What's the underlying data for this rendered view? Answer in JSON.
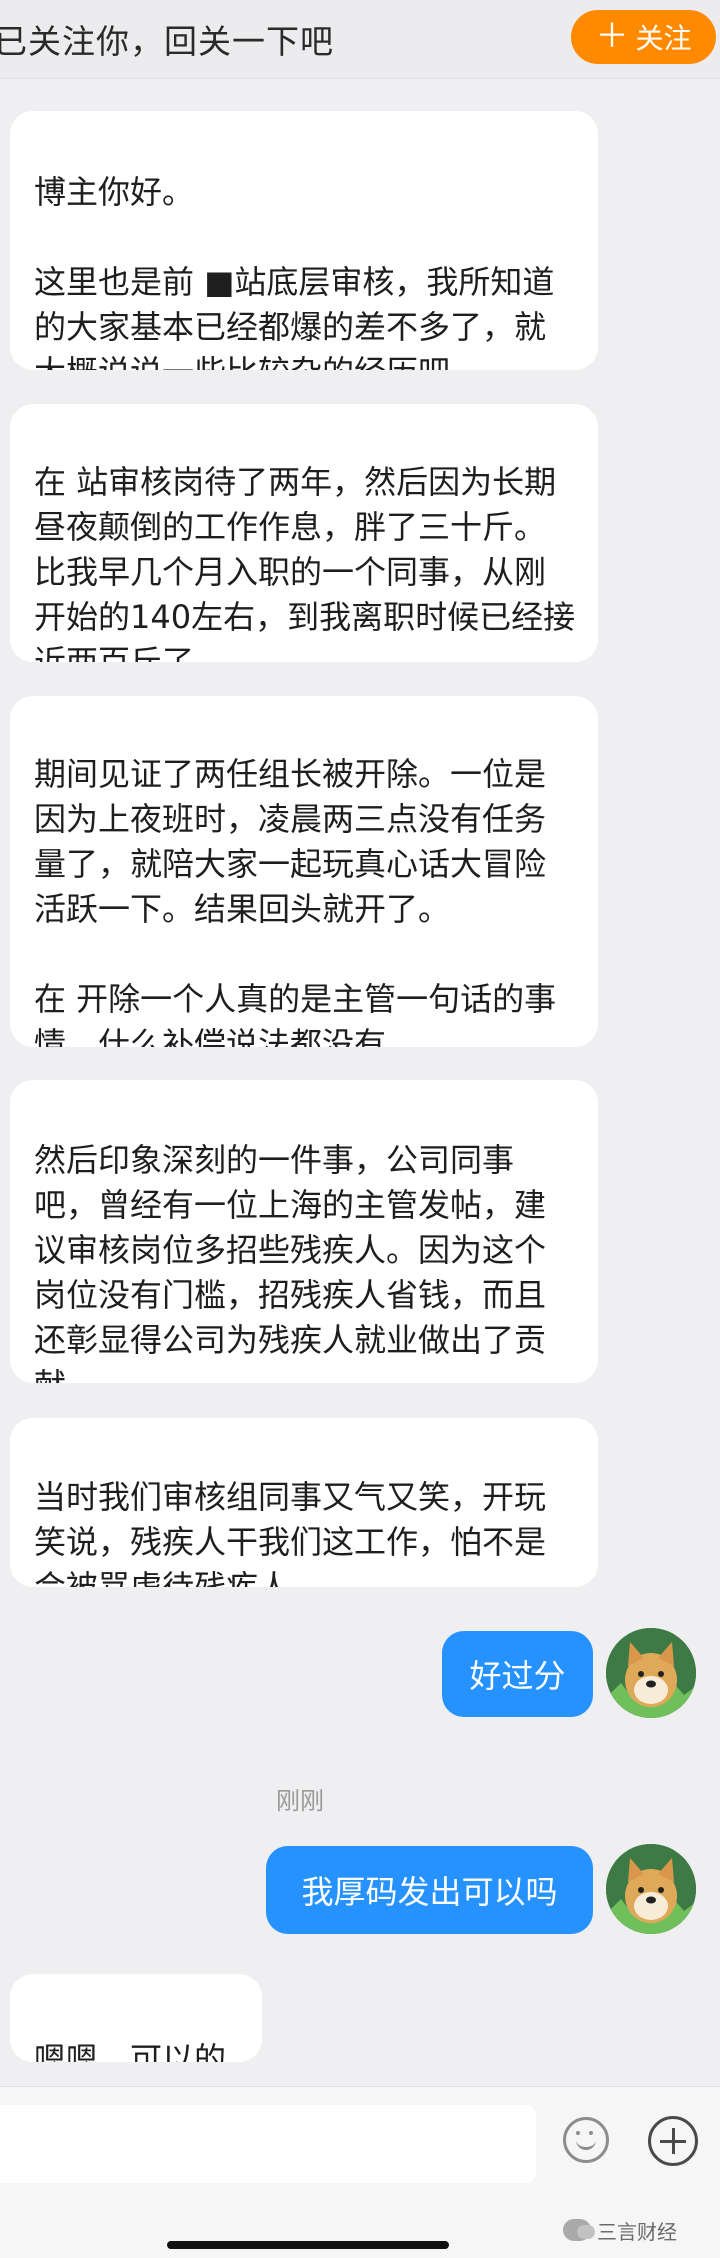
{
  "header": {
    "notice_text": "已关注你，回关一下吧",
    "follow_button": {
      "icon": "plus-icon",
      "icon_glyph": "＋",
      "label": "关注",
      "color": "#ff8a00"
    }
  },
  "messages": [
    {
      "side": "left",
      "lines": [
        "博主你好。",
        "这里也是前 ■站底层审核，我所知道的大家基本已经都爆的差不多了，就大概说说一些比较杂的经历吧"
      ]
    },
    {
      "side": "left",
      "lines": [
        "在 站审核岗待了两年，然后因为长期昼夜颠倒的工作作息，胖了三十斤。比我早几个月入职的一个同事，从刚开始的140左右，到我离职时候已经接近两百斤了"
      ]
    },
    {
      "side": "left",
      "lines": [
        "期间见证了两任组长被开除。一位是因为上夜班时，凌晨两三点没有任务量了，就陪大家一起玩真心话大冒险活跃一下。结果回头就开了。",
        "在   开除一个人真的是主管一句话的事情。什么补偿说法都没有"
      ]
    },
    {
      "side": "left",
      "lines": [
        "然后印象深刻的一件事，公司同事吧，曾经有一位上海的主管发帖，建议审核岗位多招些残疾人。因为这个岗位没有门槛，招残疾人省钱，而且还彰显得公司为残疾人就业做出了贡献"
      ]
    },
    {
      "side": "left",
      "lines": [
        "当时我们审核组同事又气又笑，开玩笑说，残疾人干我们这工作，怕不是会被骂虐待残疾人"
      ]
    },
    {
      "side": "right",
      "text": "好过分",
      "avatar": "doge-avatar"
    },
    {
      "side": "right",
      "text": "我厚码发出可以吗",
      "avatar": "doge-avatar"
    },
    {
      "side": "left",
      "lines": [
        "嗯嗯，可以的"
      ]
    }
  ],
  "timestamp": "刚刚",
  "input_bar": {
    "emoji_icon": "smiley-icon",
    "plus_icon": "plus-circle-icon"
  },
  "watermark": {
    "icon": "wechat-icon",
    "text": "三言财经"
  },
  "colors": {
    "accent_orange": "#ff8a00",
    "sent_bubble": "#2692ff",
    "background": "#efeff1"
  }
}
